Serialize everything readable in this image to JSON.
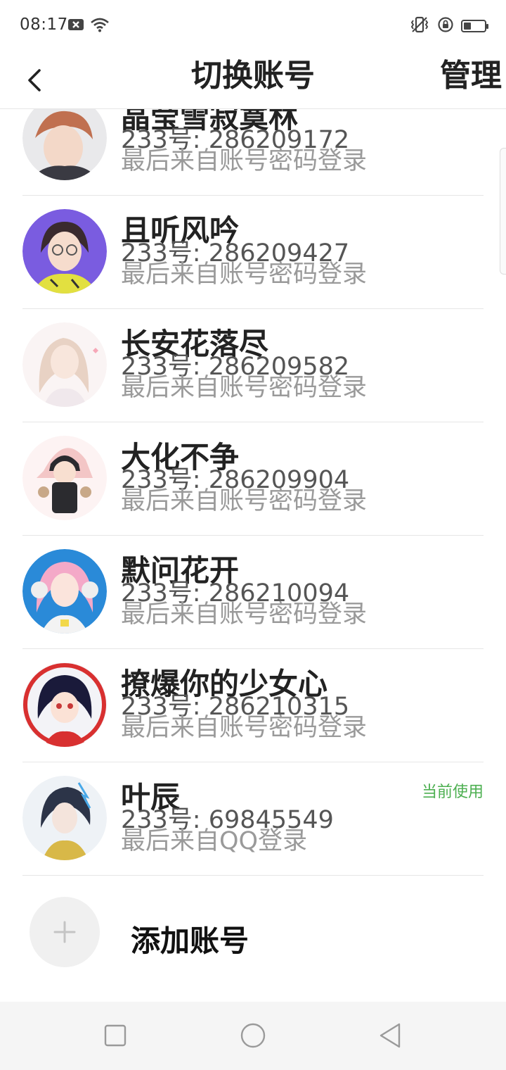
{
  "status_bar": {
    "time": "08:17",
    "icons": [
      "notification-x-icon",
      "wifi-icon",
      "vibrate-icon",
      "rotation-lock-icon",
      "battery-icon"
    ],
    "battery_level": 0.35
  },
  "header": {
    "back_icon": "chevron-left-icon",
    "title": "切换账号",
    "manage_label": "管理"
  },
  "accounts": [
    {
      "name": "晶莹雪寂寞林",
      "id": "233号: 286209172",
      "login": "最后来自账号密码登录",
      "current": "",
      "avatar_colors": [
        "#e8e8ea",
        "#b86a4a"
      ]
    },
    {
      "name": "且听风吟",
      "id": "233号: 286209427",
      "login": "最后来自账号密码登录",
      "current": "",
      "avatar_colors": [
        "#7a5ce0",
        "#e8e040"
      ]
    },
    {
      "name": "长安花落尽",
      "id": "233号: 286209582",
      "login": "最后来自账号密码登录",
      "current": "",
      "avatar_colors": [
        "#f6eeee",
        "#e6cfc2"
      ]
    },
    {
      "name": "大化不争",
      "id": "233号: 286209904",
      "login": "最后来自账号密码登录",
      "current": "",
      "avatar_colors": [
        "#fbefef",
        "#2b2b2f"
      ]
    },
    {
      "name": "默问花开",
      "id": "233号: 286210094",
      "login": "最后来自账号密码登录",
      "current": "",
      "avatar_colors": [
        "#2a8ad8",
        "#f4a9c8"
      ]
    },
    {
      "name": "撩爆你的少女心",
      "id": "233号: 286210315",
      "login": "最后来自账号密码登录",
      "current": "",
      "avatar_colors": [
        "#d83030",
        "#1a1a3a"
      ]
    },
    {
      "name": "叶辰",
      "id": "233号: 69845549",
      "login": "最后来自QQ登录",
      "current": "当前使用",
      "avatar_colors": [
        "#eef2f6",
        "#3a4860"
      ]
    }
  ],
  "add_account": {
    "icon": "plus-icon",
    "label": "添加账号"
  },
  "nav_bar": {
    "icons": [
      "recent-apps-icon",
      "home-icon",
      "back-triangle-icon"
    ]
  },
  "colors": {
    "current_badge": "#4caf50",
    "divider": "#e6e6e6",
    "nav_bg": "#f5f5f5"
  }
}
